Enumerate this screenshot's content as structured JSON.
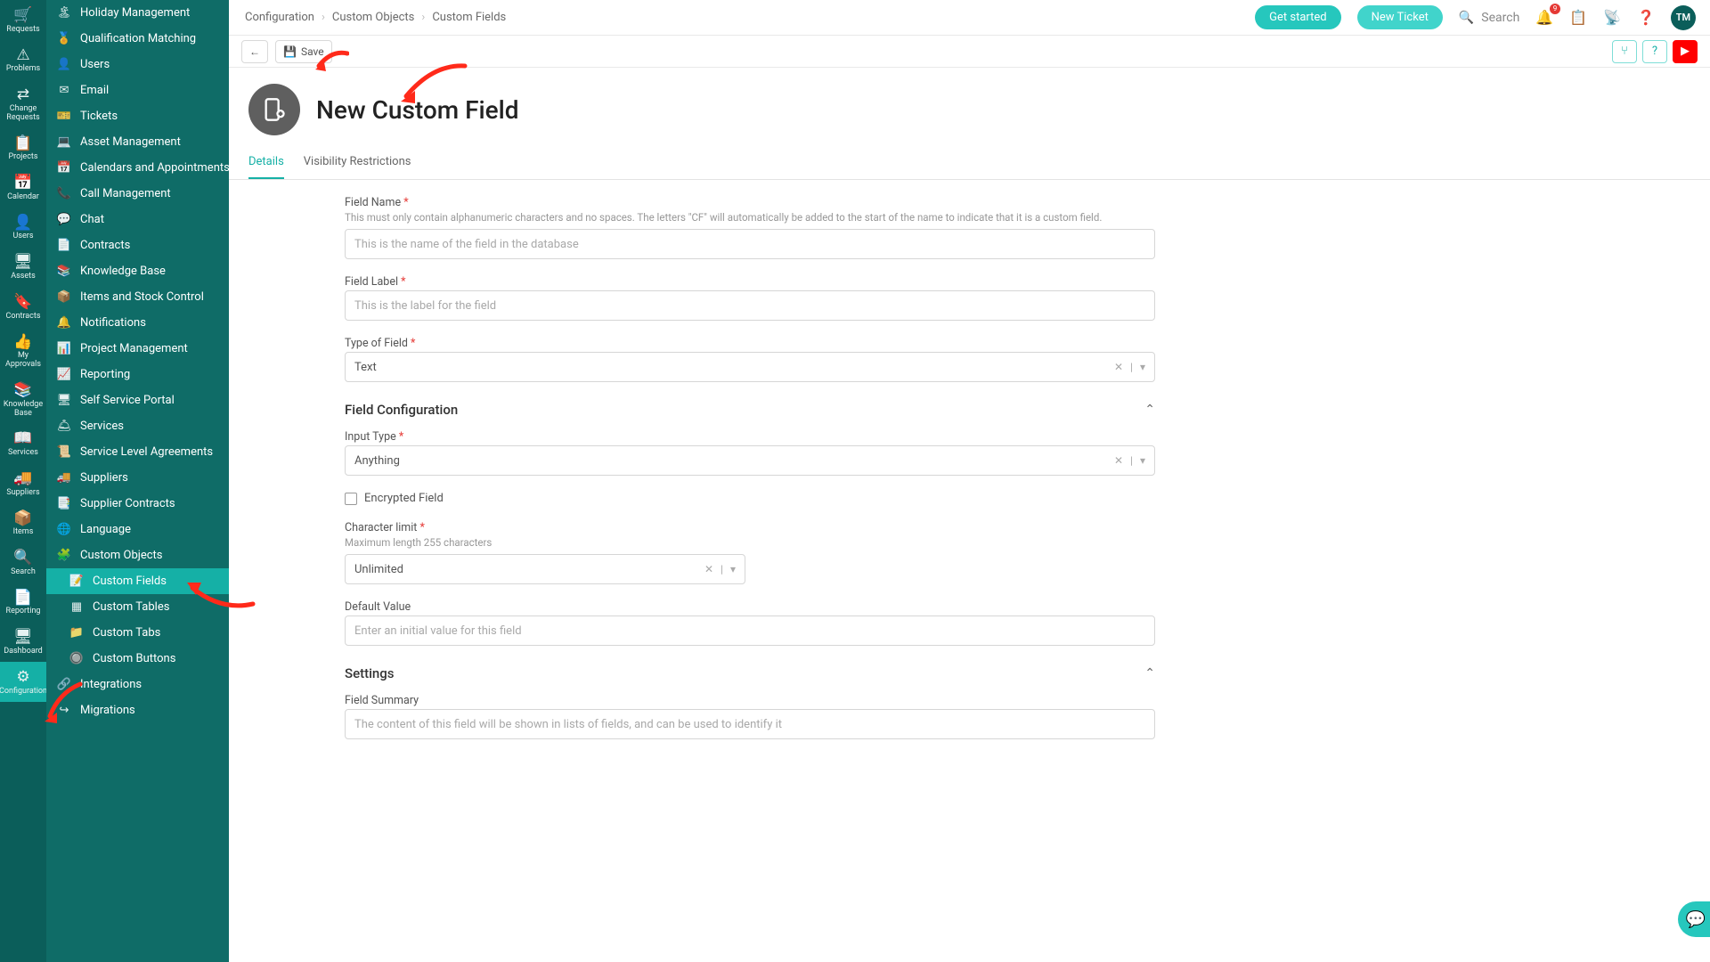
{
  "iconbar": [
    {
      "icon": "🛒",
      "label": "Requests"
    },
    {
      "icon": "⚠",
      "label": "Problems"
    },
    {
      "icon": "⇄",
      "label": "Change Requests"
    },
    {
      "icon": "📋",
      "label": "Projects"
    },
    {
      "icon": "📅",
      "label": "Calendar"
    },
    {
      "icon": "👤",
      "label": "Users"
    },
    {
      "icon": "🖥",
      "label": "Assets"
    },
    {
      "icon": "🔖",
      "label": "Contracts"
    },
    {
      "icon": "👍",
      "label": "My Approvals"
    },
    {
      "icon": "📚",
      "label": "Knowledge Base"
    },
    {
      "icon": "📖",
      "label": "Services"
    },
    {
      "icon": "🚚",
      "label": "Suppliers"
    },
    {
      "icon": "📦",
      "label": "Items"
    },
    {
      "icon": "🔍",
      "label": "Search"
    },
    {
      "icon": "📄",
      "label": "Reporting"
    },
    {
      "icon": "🖥",
      "label": "Dashboard"
    },
    {
      "icon": "⚙",
      "label": "Configuration",
      "active": true
    }
  ],
  "sidebar": [
    {
      "icon": "🏝",
      "label": "Holiday Management"
    },
    {
      "icon": "🏅",
      "label": "Qualification Matching"
    },
    {
      "icon": "👤",
      "label": "Users"
    },
    {
      "icon": "✉",
      "label": "Email"
    },
    {
      "icon": "🎫",
      "label": "Tickets"
    },
    {
      "icon": "💻",
      "label": "Asset Management"
    },
    {
      "icon": "📅",
      "label": "Calendars and Appointments"
    },
    {
      "icon": "📞",
      "label": "Call Management"
    },
    {
      "icon": "💬",
      "label": "Chat"
    },
    {
      "icon": "📄",
      "label": "Contracts"
    },
    {
      "icon": "📚",
      "label": "Knowledge Base"
    },
    {
      "icon": "📦",
      "label": "Items and Stock Control"
    },
    {
      "icon": "🔔",
      "label": "Notifications"
    },
    {
      "icon": "📊",
      "label": "Project Management"
    },
    {
      "icon": "📈",
      "label": "Reporting"
    },
    {
      "icon": "🖥",
      "label": "Self Service Portal"
    },
    {
      "icon": "🛎",
      "label": "Services"
    },
    {
      "icon": "📜",
      "label": "Service Level Agreements"
    },
    {
      "icon": "🚚",
      "label": "Suppliers"
    },
    {
      "icon": "📑",
      "label": "Supplier Contracts"
    },
    {
      "icon": "🌐",
      "label": "Language"
    },
    {
      "icon": "🧩",
      "label": "Custom Objects"
    },
    {
      "icon": "📝",
      "label": "Custom Fields",
      "sub": true,
      "active": true
    },
    {
      "icon": "▦",
      "label": "Custom Tables",
      "sub": true
    },
    {
      "icon": "📁",
      "label": "Custom Tabs",
      "sub": true
    },
    {
      "icon": "🔘",
      "label": "Custom Buttons",
      "sub": true
    },
    {
      "icon": "🔗",
      "label": "Integrations"
    },
    {
      "icon": "↪",
      "label": "Migrations"
    }
  ],
  "breadcrumbs": [
    "Configuration",
    "Custom Objects",
    "Custom Fields"
  ],
  "header": {
    "get_started": "Get started",
    "new_ticket": "New Ticket",
    "search_placeholder": "Search",
    "notif_count": "9",
    "avatar": "TM"
  },
  "toolbar": {
    "save": "Save"
  },
  "page_title": "New Custom Field",
  "tabs": [
    {
      "label": "Details",
      "active": true
    },
    {
      "label": "Visibility Restrictions"
    }
  ],
  "form": {
    "field_name": {
      "label": "Field Name",
      "help": "This must only contain alphanumeric characters and no spaces. The letters \"CF\" will automatically be added to the start of the name to indicate that it is a custom field.",
      "placeholder": "This is the name of the field in the database"
    },
    "field_label": {
      "label": "Field Label",
      "placeholder": "This is the label for the field"
    },
    "type_of_field": {
      "label": "Type of Field",
      "value": "Text"
    },
    "section_config": "Field Configuration",
    "input_type": {
      "label": "Input Type",
      "value": "Anything"
    },
    "encrypted": "Encrypted Field",
    "char_limit": {
      "label": "Character limit",
      "help": "Maximum length 255 characters",
      "value": "Unlimited"
    },
    "default_value": {
      "label": "Default Value",
      "placeholder": "Enter an initial value for this field"
    },
    "section_settings": "Settings",
    "field_summary": {
      "label": "Field Summary",
      "placeholder": "The content of this field will be shown in lists of fields, and can be used to identify it"
    }
  }
}
